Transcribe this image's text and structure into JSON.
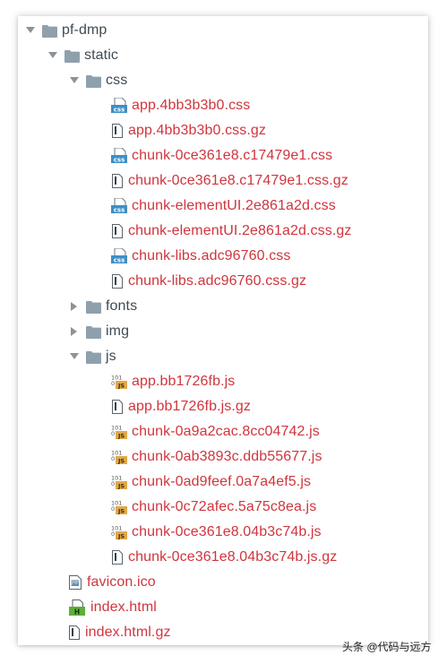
{
  "tree": {
    "root": {
      "label": "pf-dmp",
      "expanded": true,
      "icon": "folder-icon"
    },
    "static": {
      "label": "static",
      "expanded": true,
      "icon": "folder-icon"
    },
    "css": {
      "label": "css",
      "expanded": true,
      "icon": "folder-icon"
    },
    "css_files": [
      {
        "label": "app.4bb3b3b0.css",
        "icon": "css-file-icon"
      },
      {
        "label": "app.4bb3b3b0.css.gz",
        "icon": "text-file-icon"
      },
      {
        "label": "chunk-0ce361e8.c17479e1.css",
        "icon": "css-file-icon"
      },
      {
        "label": "chunk-0ce361e8.c17479e1.css.gz",
        "icon": "text-file-icon"
      },
      {
        "label": "chunk-elementUI.2e861a2d.css",
        "icon": "css-file-icon"
      },
      {
        "label": "chunk-elementUI.2e861a2d.css.gz",
        "icon": "text-file-icon"
      },
      {
        "label": "chunk-libs.adc96760.css",
        "icon": "css-file-icon"
      },
      {
        "label": "chunk-libs.adc96760.css.gz",
        "icon": "text-file-icon"
      }
    ],
    "fonts": {
      "label": "fonts",
      "expanded": false,
      "icon": "folder-icon"
    },
    "img": {
      "label": "img",
      "expanded": false,
      "icon": "folder-icon"
    },
    "js": {
      "label": "js",
      "expanded": true,
      "icon": "folder-icon"
    },
    "js_files": [
      {
        "label": "app.bb1726fb.js",
        "icon": "js-file-icon"
      },
      {
        "label": "app.bb1726fb.js.gz",
        "icon": "text-file-icon"
      },
      {
        "label": "chunk-0a9a2cac.8cc04742.js",
        "icon": "js-file-icon"
      },
      {
        "label": "chunk-0ab3893c.ddb55677.js",
        "icon": "js-file-icon"
      },
      {
        "label": "chunk-0ad9feef.0a7a4ef5.js",
        "icon": "js-file-icon"
      },
      {
        "label": "chunk-0c72afec.5a75c8ea.js",
        "icon": "js-file-icon"
      },
      {
        "label": "chunk-0ce361e8.04b3c74b.js",
        "icon": "js-file-icon"
      },
      {
        "label": "chunk-0ce361e8.04b3c74b.js.gz",
        "icon": "text-file-icon"
      }
    ],
    "favicon": {
      "label": "favicon.ico",
      "icon": "image-file-icon"
    },
    "index_html": {
      "label": "index.html",
      "icon": "html-file-icon"
    },
    "index_html_gz": {
      "label": "index.html.gz",
      "icon": "text-file-icon"
    }
  },
  "colors": {
    "folder_text": "#3f4a52",
    "file_text": "#d0353d",
    "folder_icon": "#8fa0ad",
    "css_icon": "#3d8fc4",
    "js_icon": "#e1a84a"
  },
  "watermark": "头条 @代码与远方"
}
